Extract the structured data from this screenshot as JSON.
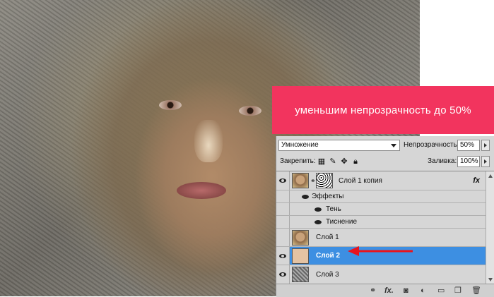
{
  "annotation": {
    "text": "уменьшим непрозрачность  до 50%",
    "color": "#f2345e"
  },
  "layers_panel": {
    "blend_mode": "Умножение",
    "opacity_label": "Непрозрачность:",
    "opacity_value": "50%",
    "lock_label": "Закрепить:",
    "fill_label": "Заливка:",
    "fill_value": "100%",
    "layers": [
      {
        "name": "Слой 1 копия",
        "visible": true,
        "has_fx": true,
        "fx_label": "fx"
      },
      {
        "name": "Эффекты",
        "type": "effects-group"
      },
      {
        "name": "Тень",
        "type": "effect"
      },
      {
        "name": "Тиснение",
        "type": "effect"
      },
      {
        "name": "Слой 1",
        "visible": false
      },
      {
        "name": "Слой 2",
        "visible": true,
        "selected": true
      },
      {
        "name": "Слой 3",
        "visible": true
      }
    ],
    "selected_color": "#3d8fe2",
    "bottom_fx_label": "fx."
  }
}
